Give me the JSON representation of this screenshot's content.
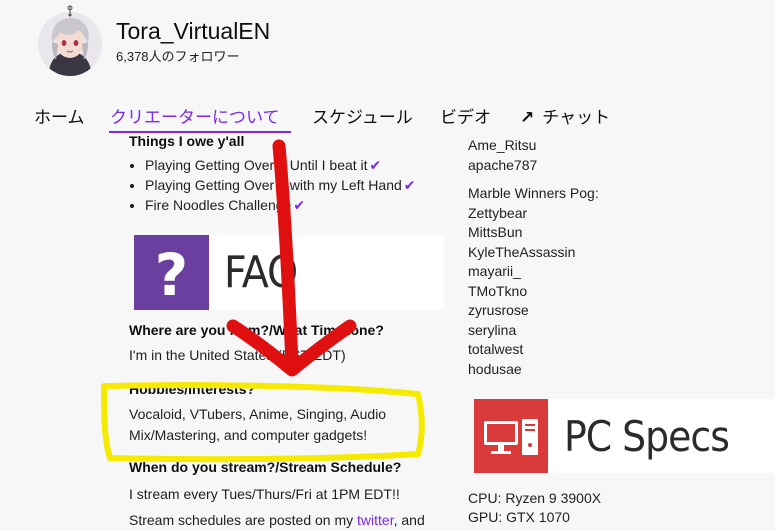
{
  "channel": {
    "name": "Tora_VirtualEN",
    "followers": "6,378人のフォロワー"
  },
  "tabs": [
    {
      "label": "ホーム"
    },
    {
      "label": "クリエーターについて"
    },
    {
      "label": "スケジュール"
    },
    {
      "label": "ビデオ"
    },
    {
      "label": "チャット"
    }
  ],
  "about": {
    "owe_heading": "Things I owe y'all",
    "owe_items": [
      "Playing Getting Over It Until I beat it",
      "Playing Getting Over It with my Left Hand",
      "Fire Noodles Challenge"
    ],
    "faq_banner": "FAQ",
    "q_where": "Where are you from?/What Timezone?",
    "a_where": "I'm in the United States (EST/EDT)",
    "q_hobbies": "Hobbies/Interests?",
    "a_hobbies": "Vocaloid, VTubers, Anime, Singing, Audio Mix/Mastering, and computer gadgets!",
    "q_stream": "When do you stream?/Stream Schedule?",
    "a_stream": "I stream every Tues/Thurs/Fri at 1PM EDT!!",
    "a_schedule_prefix": "Stream schedules are posted on my",
    "a_schedule_link": "twitter",
    "a_schedule_suffix": ", and"
  },
  "right_column": {
    "names_top": [
      "Ame_Ritsu",
      "apache787"
    ],
    "marble_heading": "Marble Winners Pog:",
    "marble_winners": [
      "Zettybear",
      "MittsBun",
      "KyleTheAssassin",
      "mayarii_",
      "TMoTkno",
      "zyrusrose",
      "serylina",
      "totalwest",
      "hodusae"
    ],
    "pc_banner": "PC Specs",
    "specs": [
      "CPU: Ryzen 9 3900X",
      "GPU: GTX 1070"
    ]
  },
  "colors": {
    "accent": "#772ce8",
    "faq_icon_bg": "#6b3fa0",
    "pc_icon_bg": "#d93a3a",
    "annotation_red": "#e01010",
    "annotation_yellow": "#f5ea00"
  }
}
